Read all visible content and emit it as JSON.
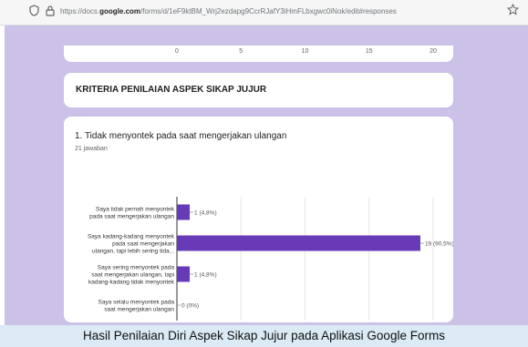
{
  "browser": {
    "url_prefix": "https://docs.",
    "url_domain": "google.com",
    "url_rest": "/forms/d/1eF9ktBM_Wrj2ezdapg9CcrRJafY3iHmFLbxgwc0iNok/edit#responses",
    "icons": {
      "shield": "shield-icon",
      "lock": "lock-icon",
      "bookmark": "star-icon"
    }
  },
  "prev_chart_ticks": [
    "0",
    "5",
    "10",
    "15",
    "20"
  ],
  "section": {
    "title": "KRITERIA PENILAIAN ASPEK SIKAP JUJUR"
  },
  "question": {
    "title": "1. Tidak menyontek pada saat mengerjakan ulangan",
    "response_count": "21 jawaban"
  },
  "chart_data": {
    "type": "bar",
    "orientation": "horizontal",
    "categories": [
      [
        "Saya tidak pernah menyontek",
        "pada saat mengerjakan ulangan"
      ],
      [
        "Saya kadang-kadang menyontek",
        "pada saat mengerjakan",
        "ulangan, tapi lebih sering tida..."
      ],
      [
        "Saya sering menyontek pada",
        "saat mengerjakan ulangan, tapi",
        "kadang-kadang tidak menyontek"
      ],
      [
        "Saya selalu menyontek pada",
        "saat mengerjakan ulangan"
      ]
    ],
    "values": [
      1,
      19,
      1,
      0
    ],
    "data_labels": [
      "1 (4,8%)",
      "19 (90,5%)",
      "1 (4,8%)",
      "0 (0%)"
    ],
    "xlim": [
      0,
      20
    ],
    "ticks": [
      "0",
      "5",
      "10",
      "15",
      "20"
    ],
    "bar_color": "#673ab7"
  },
  "caption": "Hasil Penilaian Diri Aspek Sikap Jujur pada Aplikasi Google Forms",
  "colors": {
    "background": "#ccc1e6",
    "accent": "#673ab7"
  }
}
